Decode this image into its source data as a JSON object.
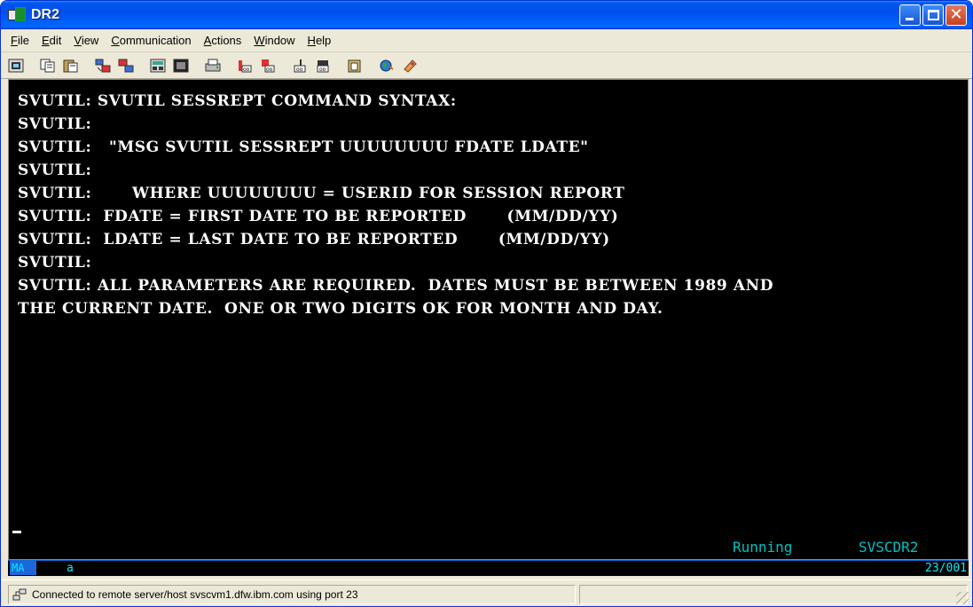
{
  "window": {
    "title": "DR2"
  },
  "menu": {
    "items": [
      {
        "label": "File",
        "u": "F",
        "rest": "ile"
      },
      {
        "label": "Edit",
        "u": "E",
        "rest": "dit"
      },
      {
        "label": "View",
        "u": "V",
        "rest": "iew"
      },
      {
        "label": "Communication",
        "u": "C",
        "rest": "ommunication"
      },
      {
        "label": "Actions",
        "u": "A",
        "rest": "ctions"
      },
      {
        "label": "Window",
        "u": "W",
        "rest": "indow"
      },
      {
        "label": "Help",
        "u": "H",
        "rest": "elp"
      }
    ]
  },
  "toolbar": {
    "icons": [
      "screen-icon",
      "copy-icon",
      "paste-icon",
      "send-icon",
      "receive-icon",
      "keypad-icon",
      "display-icon",
      "print-icon",
      "macro-record-icon",
      "macro-stop-icon",
      "macro-play-icon",
      "macro-edit-icon",
      "clipboard-icon",
      "globe-icon",
      "ticket-icon"
    ]
  },
  "terminal": {
    "lines": [
      "SVUTIL: SVUTIL SESSREPT COMMAND SYNTAX:",
      "SVUTIL:",
      "SVUTIL:   \"MSG SVUTIL SESSREPT UUUUUUUU FDATE LDATE\"",
      "SVUTIL:",
      "SVUTIL:       WHERE UUUUUUUU = USERID FOR SESSION REPORT",
      "SVUTIL:  FDATE = FIRST DATE TO BE REPORTED       (MM/DD/YY)",
      "SVUTIL:  LDATE = LAST DATE TO BE REPORTED       (MM/DD/YY)",
      "SVUTIL:",
      "SVUTIL: ALL PARAMETERS ARE REQUIRED.  DATES MUST BE BETWEEN 1989 AND",
      "THE CURRENT DATE.  ONE OR TWO DIGITS OK FOR MONTH AND DAY."
    ],
    "status": "Running",
    "session": "SVSCDR2"
  },
  "oia": {
    "indicator": "MA",
    "session_letter": "a",
    "cursor_pos": "23/001"
  },
  "statusbar": {
    "message": "Connected to remote server/host svscvm1.dfw.ibm.com using port 23"
  }
}
